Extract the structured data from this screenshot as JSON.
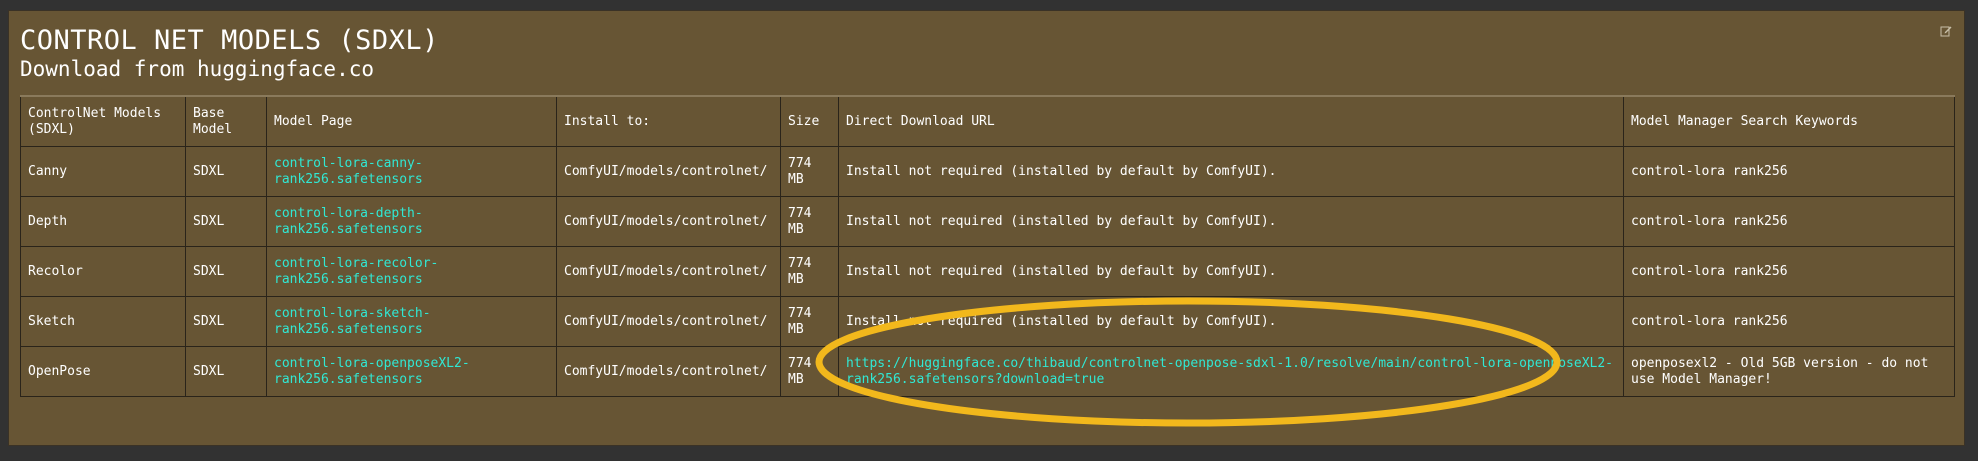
{
  "card": {
    "title": "CONTROL NET MODELS (SDXL)",
    "subtitle": "Download from huggingface.co",
    "edit_icon": "edit-icon"
  },
  "table": {
    "headers": [
      "ControlNet Models (SDXL)",
      "Base Model",
      "Model Page",
      "Install to:",
      "Size",
      "Direct Download URL",
      "Model Manager Search Keywords"
    ],
    "rows": [
      {
        "model": "Canny",
        "base": "SDXL",
        "page": "control-lora-canny-rank256.safetensors",
        "install": "ComfyUI/models/controlnet/",
        "size": "774 MB",
        "url": "Install not required (installed by default by ComfyUI).",
        "keywords": "control-lora rank256"
      },
      {
        "model": "Depth",
        "base": "SDXL",
        "page": "control-lora-depth-rank256.safetensors",
        "install": "ComfyUI/models/controlnet/",
        "size": "774 MB",
        "url": "Install not required (installed by default by ComfyUI).",
        "keywords": "control-lora rank256"
      },
      {
        "model": "Recolor",
        "base": "SDXL",
        "page": "control-lora-recolor-rank256.safetensors",
        "install": "ComfyUI/models/controlnet/",
        "size": "774 MB",
        "url": "Install not required (installed by default by ComfyUI).",
        "keywords": "control-lora rank256"
      },
      {
        "model": "Sketch",
        "base": "SDXL",
        "page": "control-lora-sketch-rank256.safetensors",
        "install": "ComfyUI/models/controlnet/",
        "size": "774 MB",
        "url": "Install not required (installed by default by ComfyUI).",
        "keywords": "control-lora rank256"
      },
      {
        "model": "OpenPose",
        "base": "SDXL",
        "page": "control-lora-openposeXL2-rank256.safetensors",
        "install": "ComfyUI/models/controlnet/",
        "size": "774 MB",
        "url": "https://huggingface.co/thibaud/controlnet-openpose-sdxl-1.0/resolve/main/control-lora-openposeXL2-rank256.safetensors?download=true",
        "keywords": "openposexl2 - Old 5GB version - do not use Model Manager!"
      }
    ]
  },
  "colors": {
    "card_background": "#675534",
    "page_background": "#323232",
    "link": "#30e8d4",
    "highlight_ellipse": "#f2b81c"
  }
}
